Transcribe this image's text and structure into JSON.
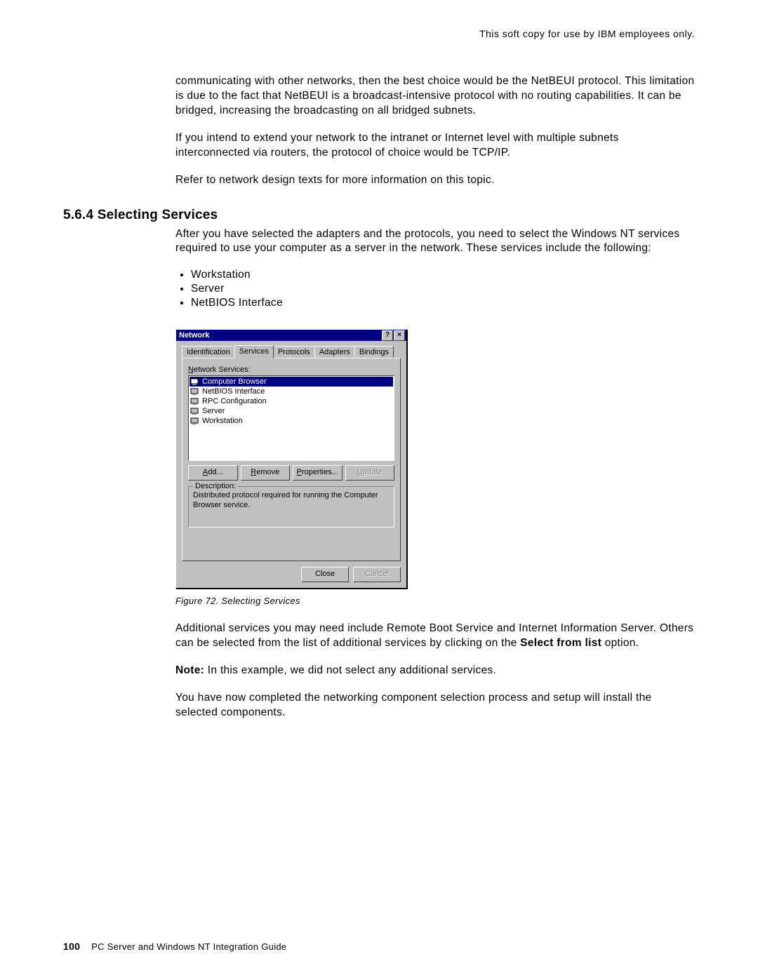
{
  "header": {
    "right": "This soft copy for use by IBM employees only."
  },
  "body": {
    "p1": "communicating with other networks, then the best choice would be the NetBEUI protocol. This limitation is due to the fact that NetBEUI is a broadcast-intensive protocol with no routing capabilities. It can be bridged, increasing the broadcasting on all bridged subnets.",
    "p2": "If you intend to extend your network to the intranet or Internet level with multiple subnets interconnected via routers, the protocol of choice would be TCP/IP.",
    "p3": "Refer to network design texts for more information on this topic.",
    "heading": "5.6.4  Selecting Services",
    "p4": "After you have selected the adapters and the protocols, you need to select the Windows NT services required to use your computer as a server in the network. These services include the following:",
    "bullets": [
      "Workstation",
      "Server",
      "NetBIOS Interface"
    ],
    "caption": "Figure 72. Selecting Services",
    "p5a": "Additional services you may need include Remote Boot Service and Internet Information Server. Others can be selected from the list of additional services by clicking on the ",
    "p5b": "Select from list",
    "p5c": " option.",
    "p6a": "Note:",
    "p6b": "  In this example, we did not select any additional services.",
    "p7": "You have now completed the networking component selection process and setup will install the selected components."
  },
  "dialog": {
    "title": "Network",
    "help_btn": "?",
    "close_btn": "×",
    "tabs": [
      "Identification",
      "Services",
      "Protocols",
      "Adapters",
      "Bindings"
    ],
    "active_tab": "Services",
    "list_label_pre": "N",
    "list_label_rest": "etwork Services:",
    "services": [
      "Computer Browser",
      "NetBIOS Interface",
      "RPC Configuration",
      "Server",
      "Workstation"
    ],
    "selected_service": "Computer Browser",
    "buttons": {
      "add_u": "A",
      "add_r": "dd...",
      "remove_u": "R",
      "remove_r": "emove",
      "props_u": "P",
      "props_r": "roperties...",
      "update_u": "U",
      "update_r": "pdate"
    },
    "desc_label": "Description:",
    "desc_text": "Distributed protocol required for running the Computer Browser service.",
    "close": "Close",
    "cancel": "Cancel"
  },
  "footer": {
    "page": "100",
    "title": "PC Server and Windows NT Integration Guide"
  }
}
